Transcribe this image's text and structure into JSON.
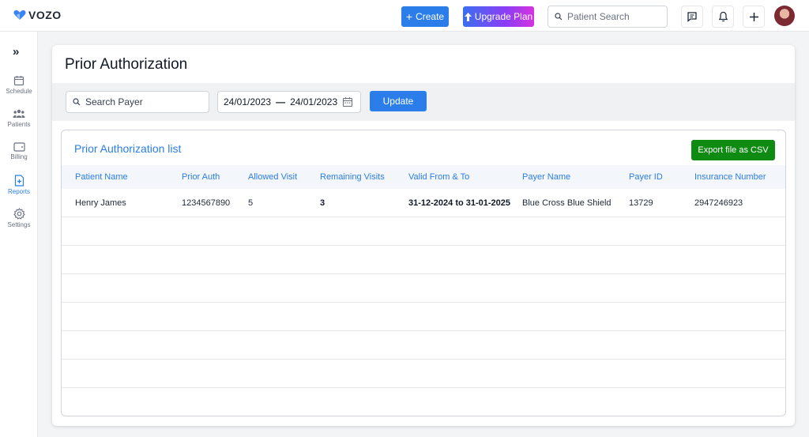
{
  "brand": {
    "name": "VOZO",
    "color": "#3b82f6"
  },
  "header": {
    "create_label": "Create",
    "upgrade_label": "Upgrade Plan",
    "patient_search_placeholder": "Patient Search"
  },
  "sidebar": {
    "items": [
      {
        "label": "Schedule",
        "icon": "calendar-icon"
      },
      {
        "label": "Patients",
        "icon": "patients-icon"
      },
      {
        "label": "Billing",
        "icon": "wallet-icon"
      },
      {
        "label": "Reports",
        "icon": "report-icon",
        "active": true
      },
      {
        "label": "Settings",
        "icon": "gear-icon"
      }
    ]
  },
  "page": {
    "title": "Prior Authorization",
    "search_payer_placeholder": "Search Payer",
    "date_from": "24/01/2023",
    "date_to": "24/01/2023",
    "update_label": "Update"
  },
  "list": {
    "title": "Prior Authorization list",
    "export_label": "Export file as CSV",
    "columns": [
      "Patient Name",
      "Prior Auth",
      "Allowed Visit",
      "Remaining Visits",
      "Valid From & To",
      "Payer Name",
      "Payer ID",
      "Insurance Number"
    ],
    "rows": [
      {
        "patient_name": "Henry James",
        "prior_auth": "1234567890",
        "allowed_visit": "5",
        "remaining_visits": "3",
        "valid_range": "31-12-2024 to 31-01-2025",
        "payer_name": "Blue Cross Blue Shield",
        "payer_id": "13729",
        "insurance_number": "2947246923"
      }
    ]
  },
  "colors": {
    "primary": "#2b7de9",
    "export": "#0f8a13"
  }
}
